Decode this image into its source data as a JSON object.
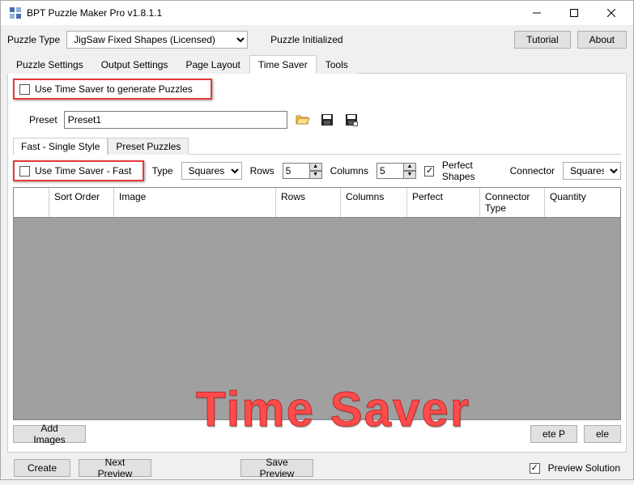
{
  "window": {
    "title": "BPT Puzzle Maker Pro v1.8.1.1"
  },
  "topbar": {
    "puzzle_type_label": "Puzzle Type",
    "puzzle_type_value": "JigSaw Fixed Shapes (Licensed)",
    "status": "Puzzle Initialized",
    "tutorial": "Tutorial",
    "about": "About"
  },
  "tabs": {
    "items": [
      "Puzzle Settings",
      "Output Settings",
      "Page Layout",
      "Time Saver",
      "Tools"
    ],
    "active": "Time Saver"
  },
  "time_saver": {
    "use_ts_label": "Use Time Saver to generate Puzzles",
    "preset_label": "Preset",
    "preset_value": "Preset1"
  },
  "subtabs": {
    "items": [
      "Fast - Single Style",
      "Preset Puzzles"
    ],
    "active": "Fast - Single Style"
  },
  "fast": {
    "use_fast_label": "Use Time Saver - Fast",
    "type_label": "Type",
    "type_value": "Squares",
    "rows_label": "Rows",
    "rows_value": "5",
    "cols_label": "Columns",
    "cols_value": "5",
    "perfect_label": "Perfect Shapes",
    "connector_label": "Connector",
    "connector_value": "Squares"
  },
  "table_headers": [
    "",
    "Sort Order",
    "Image",
    "Rows",
    "Columns",
    "Perfect",
    "Connector Type",
    "Quantity"
  ],
  "buttons": {
    "add_images": "Add Images",
    "partial1": "ete P",
    "partial2": "ele",
    "create": "Create",
    "next_preview": "Next Preview",
    "save_preview": "Save Preview",
    "preview_solution": "Preview Solution"
  },
  "overlay": "Time Saver"
}
